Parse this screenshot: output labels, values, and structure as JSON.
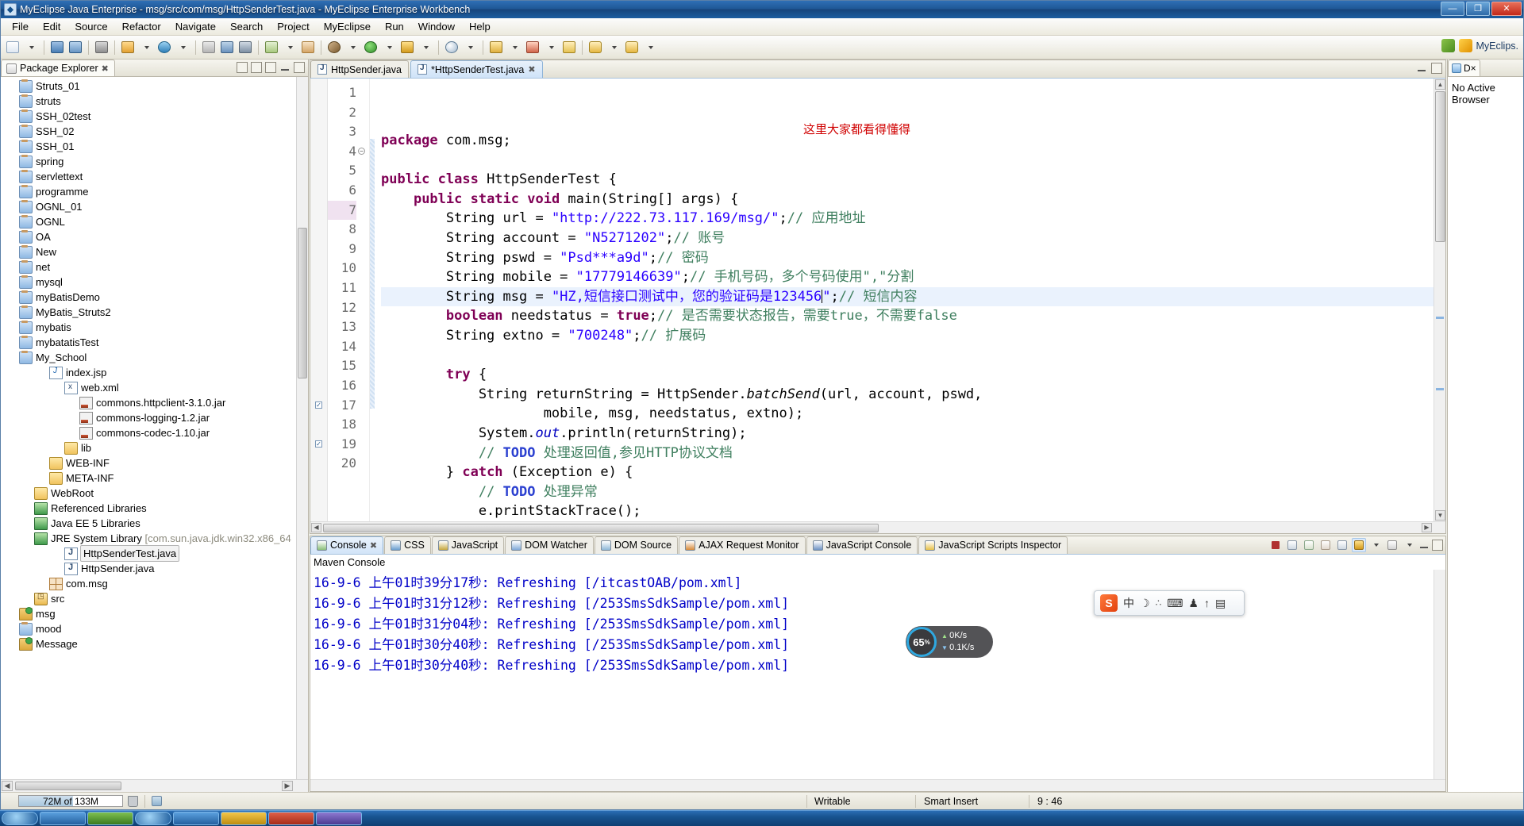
{
  "window": {
    "title": "MyEclipse Java Enterprise - msg/src/com/msg/HttpSenderTest.java - MyEclipse Enterprise Workbench",
    "app_icon": "myeclipse-icon",
    "minimize_label": "—",
    "maximize_label": "❐",
    "close_label": "✕"
  },
  "menu": {
    "items": [
      "File",
      "Edit",
      "Source",
      "Refactor",
      "Navigate",
      "Search",
      "Project",
      "MyEclipse",
      "Run",
      "Window",
      "Help"
    ]
  },
  "toolbar": {
    "brand_label": "MyEclips."
  },
  "explorer": {
    "tab_label": "Package Explorer",
    "tab_close": "✖",
    "tree": [
      {
        "label": "Message",
        "indent": 1,
        "icon": "project-icon",
        "selected": false
      },
      {
        "label": "mood",
        "indent": 1,
        "icon": "folder-blue-icon",
        "selected": false
      },
      {
        "label": "msg",
        "indent": 1,
        "icon": "project-open-icon",
        "selected": false
      },
      {
        "label": "src",
        "indent": 2,
        "icon": "source-folder-icon",
        "selected": false
      },
      {
        "label": "com.msg",
        "indent": 3,
        "icon": "package-icon",
        "selected": false
      },
      {
        "label": "HttpSender.java",
        "indent": 4,
        "icon": "java-file-icon",
        "selected": false
      },
      {
        "label": "HttpSenderTest.java",
        "indent": 4,
        "icon": "java-file-icon",
        "selected": true
      },
      {
        "label": "JRE System Library",
        "dim": "[com.sun.java.jdk.win32.x86_64",
        "indent": 2,
        "icon": "library-icon",
        "selected": false
      },
      {
        "label": "Java EE 5 Libraries",
        "indent": 2,
        "icon": "library-icon",
        "selected": false
      },
      {
        "label": "Referenced Libraries",
        "indent": 2,
        "icon": "library-icon",
        "selected": false
      },
      {
        "label": "WebRoot",
        "indent": 2,
        "icon": "folder-yellow-icon",
        "selected": false
      },
      {
        "label": "META-INF",
        "indent": 3,
        "icon": "folder-yellow-icon",
        "selected": false
      },
      {
        "label": "WEB-INF",
        "indent": 3,
        "icon": "folder-yellow-icon",
        "selected": false
      },
      {
        "label": "lib",
        "indent": 4,
        "icon": "folder-yellow-icon",
        "selected": false
      },
      {
        "label": "commons-codec-1.10.jar",
        "indent": 5,
        "icon": "jar-icon",
        "selected": false
      },
      {
        "label": "commons-logging-1.2.jar",
        "indent": 5,
        "icon": "jar-icon",
        "selected": false
      },
      {
        "label": "commons.httpclient-3.1.0.jar",
        "indent": 5,
        "icon": "jar-icon",
        "selected": false
      },
      {
        "label": "web.xml",
        "indent": 4,
        "icon": "xml-file-icon",
        "selected": false
      },
      {
        "label": "index.jsp",
        "indent": 3,
        "icon": "jsp-file-icon",
        "selected": false
      },
      {
        "label": "My_School",
        "indent": 1,
        "icon": "folder-blue-icon",
        "selected": false
      },
      {
        "label": "mybatatisTest",
        "indent": 1,
        "icon": "folder-blue-icon",
        "selected": false
      },
      {
        "label": "mybatis",
        "indent": 1,
        "icon": "folder-blue-icon",
        "selected": false
      },
      {
        "label": "MyBatis_Struts2",
        "indent": 1,
        "icon": "folder-blue-icon",
        "selected": false
      },
      {
        "label": "myBatisDemo",
        "indent": 1,
        "icon": "folder-blue-icon",
        "selected": false
      },
      {
        "label": "mysql",
        "indent": 1,
        "icon": "folder-blue-icon",
        "selected": false
      },
      {
        "label": "net",
        "indent": 1,
        "icon": "folder-blue-icon",
        "selected": false
      },
      {
        "label": "New",
        "indent": 1,
        "icon": "folder-blue-icon",
        "selected": false
      },
      {
        "label": "OA",
        "indent": 1,
        "icon": "folder-blue-icon",
        "selected": false
      },
      {
        "label": "OGNL",
        "indent": 1,
        "icon": "folder-blue-icon",
        "selected": false
      },
      {
        "label": "OGNL_01",
        "indent": 1,
        "icon": "folder-blue-icon",
        "selected": false
      },
      {
        "label": "programme",
        "indent": 1,
        "icon": "folder-blue-icon",
        "selected": false
      },
      {
        "label": "servlettext",
        "indent": 1,
        "icon": "folder-blue-icon",
        "selected": false
      },
      {
        "label": "spring",
        "indent": 1,
        "icon": "folder-blue-icon",
        "selected": false
      },
      {
        "label": "SSH_01",
        "indent": 1,
        "icon": "folder-blue-icon",
        "selected": false
      },
      {
        "label": "SSH_02",
        "indent": 1,
        "icon": "folder-blue-icon",
        "selected": false
      },
      {
        "label": "SSH_02test",
        "indent": 1,
        "icon": "folder-blue-icon",
        "selected": false
      },
      {
        "label": "struts",
        "indent": 1,
        "icon": "folder-blue-icon",
        "selected": false
      },
      {
        "label": "Struts_01",
        "indent": 1,
        "icon": "folder-blue-icon",
        "selected": false
      }
    ]
  },
  "editor": {
    "tabs": [
      {
        "label": "*HttpSenderTest.java",
        "active": true,
        "close": "✖"
      },
      {
        "label": "HttpSender.java",
        "active": false,
        "close": ""
      }
    ],
    "annotation_red": "这里大家都看得懂得",
    "lines": [
      {
        "n": 1,
        "html": "<span class='kw'>package</span> com.msg;"
      },
      {
        "n": 2,
        "html": ""
      },
      {
        "n": 3,
        "html": "<span class='kw'>public class</span> HttpSenderTest {"
      },
      {
        "n": 4,
        "html": "    <span class='kw'>public static void</span> main(String[] args) {",
        "fold": true
      },
      {
        "n": 5,
        "html": "        String url = <span class='str'>\"http://222.73.117.169/msg/\"</span>;<span class='cmt'>// 应用地址</span>"
      },
      {
        "n": 6,
        "html": "        String account = <span class='str'>\"N5271202\"</span>;<span class='cmt'>// 账号</span>"
      },
      {
        "n": 7,
        "html": "        String pswd = <span class='str'>\"Psd***a9d\"</span>;<span class='cmt'>// 密码</span>",
        "markline": true
      },
      {
        "n": 8,
        "html": "        String mobile = <span class='str'>\"17779146639\"</span>;<span class='cmt'>// 手机号码，多个号码使用\",\"分割</span>"
      },
      {
        "n": 9,
        "html": "        String msg = <span class='str'>\"HZ,短信接口测试中，您的验证码是123456</span><span class='caret-blink'></span><span class='str'>\"</span>;<span class='cmt'>// 短信内容</span>",
        "highlight": true
      },
      {
        "n": 10,
        "html": "        <span class='kw'>boolean</span> needstatus = <span class='kw'>true</span>;<span class='cmt'>// 是否需要状态报告，需要true，不需要false</span>"
      },
      {
        "n": 11,
        "html": "        String extno = <span class='str'>\"700248\"</span>;<span class='cmt'>// 扩展码</span>"
      },
      {
        "n": 12,
        "html": ""
      },
      {
        "n": 13,
        "html": "        <span class='kw'>try</span> {"
      },
      {
        "n": 14,
        "html": "            String returnString = HttpSender.<span class='meth'>batchSend</span>(url, account, pswd,"
      },
      {
        "n": 15,
        "html": "                    mobile, msg, needstatus, extno);"
      },
      {
        "n": 16,
        "html": "            System.<span class='fld'>out</span>.println(returnString);"
      },
      {
        "n": 17,
        "html": "            <span class='cmt'>// </span><span class='todoword'>TODO</span><span class='cmt'> 处理返回值,参见HTTP协议文档</span>",
        "todo": true
      },
      {
        "n": 18,
        "html": "        } <span class='kw'>catch</span> (Exception e) {"
      },
      {
        "n": 19,
        "html": "            <span class='cmt'>// </span><span class='todoword'>TODO</span><span class='cmt'> 处理异常</span>",
        "todo": true
      },
      {
        "n": 20,
        "html": "            e.printStackTrace();"
      }
    ]
  },
  "console": {
    "tabs": [
      {
        "label": "JavaScript Scripts Inspector",
        "icon": "script-inspector-icon",
        "active": false
      },
      {
        "label": "JavaScript Console",
        "icon": "js-console-icon",
        "active": false
      },
      {
        "label": "AJAX Request Monitor",
        "icon": "ajax-monitor-icon",
        "active": false
      },
      {
        "label": "DOM Source",
        "icon": "dom-source-icon",
        "active": false
      },
      {
        "label": "DOM Watcher",
        "icon": "dom-watcher-icon",
        "active": false
      },
      {
        "label": "JavaScript",
        "icon": "javascript-icon",
        "active": false
      },
      {
        "label": "CSS",
        "icon": "css-icon",
        "active": false
      },
      {
        "label": "Console",
        "icon": "console-icon",
        "active": true,
        "close": "✖"
      }
    ],
    "title": "Maven Console",
    "lines": [
      "16-9-6 上午01时30分40秒: Refreshing [/253SmsSdkSample/pom.xml]",
      "16-9-6 上午01时30分40秒: Refreshing [/253SmsSdkSample/pom.xml]",
      "16-9-6 上午01时31分04秒: Refreshing [/253SmsSdkSample/pom.xml]",
      "16-9-6 上午01时31分12秒: Refreshing [/253SmsSdkSample/pom.xml]",
      "16-9-6 上午01时39分17秒: Refreshing [/itcastOAB/pom.xml]"
    ]
  },
  "rightpane": {
    "tab_label": "D×",
    "line1": "No Active",
    "line2": "Browser"
  },
  "statusbar": {
    "memory": "72M of 133M",
    "writable": "Writable",
    "insert_mode": "Smart Insert",
    "position": "9 : 46"
  },
  "netspeed": {
    "percent": "65",
    "percent_unit": "%",
    "upload": "0K/s",
    "download": "0.1K/s"
  },
  "ime": {
    "logo": "S",
    "mode_label": "中",
    "moon": "☽",
    "dots": "∴",
    "keyboard": "⌨",
    "toolbox": "♟",
    "up": "↑",
    "menu": "▤"
  },
  "colors": {
    "keyword": "#7f0055",
    "string": "#2a00ff",
    "comment": "#3f7f5f",
    "annotation_red": "#d00000",
    "console_text": "#0000c8",
    "title_blue": "#1f5897"
  }
}
